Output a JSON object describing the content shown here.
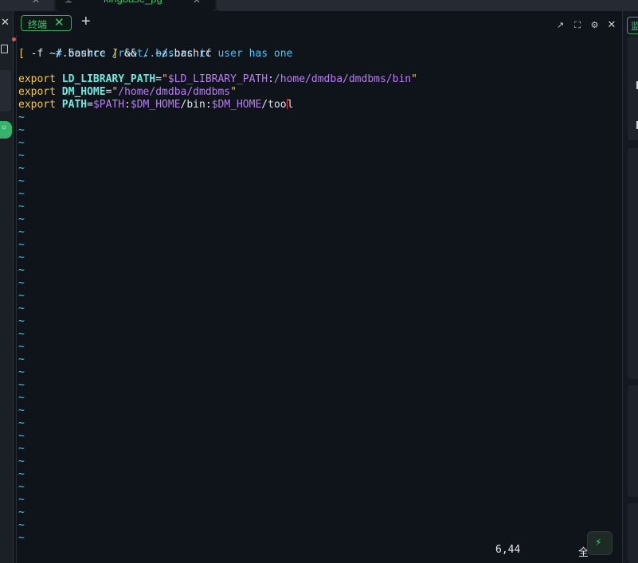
{
  "app_tabs": {
    "tab1_close": "✕",
    "tab2_pin": "⟂",
    "tab2_label": "kingbase_pg",
    "tab2_close": "✕"
  },
  "left_sidebar": {
    "close": "✕",
    "pill": "○"
  },
  "terminal_header": {
    "tab_label": "终端",
    "tab_close": "✕",
    "add": "+",
    "icons": {
      "external": "↗",
      "expand": "⛶",
      "settings": "⚙",
      "close": "✕"
    }
  },
  "terminal": {
    "lines": {
      "l1": "# Source /root/.bashrc if user has one",
      "l2_open": "[",
      "l2_mid": " -f ~/.bashrc ",
      "l2_close": "]",
      "l2_tail": " && . ~/.bashrc",
      "l4": {
        "kw": "export",
        "var": "LD_LIBRARY_PATH",
        "eq": "=",
        "q1": "\"",
        "ref": "$LD_LIBRARY_PATH",
        "sep": ":",
        "path": "/home/dmdba/dmdbms/bin",
        "q2": "\""
      },
      "l5": {
        "kw": "export",
        "var": "DM_HOME",
        "eq": "=",
        "q1": "\"",
        "path": "/home/dmdba/dmdbms",
        "q2": "\""
      },
      "l6": {
        "kw": "export",
        "var": "PATH",
        "eq": "=",
        "ref1": "$PATH",
        "sep1": ":",
        "ref2": "$DM_HOME",
        "p1": "/bin",
        "sep2": ":",
        "ref3": "$DM_HOME",
        "p2": "/too",
        "p3": "l"
      }
    },
    "tilde": "~",
    "status_position": "6,44",
    "status_all": "全",
    "bolt": "⚡"
  },
  "right_panel": {
    "tab": "监"
  },
  "colors": {
    "background": "#0f131a",
    "comment": "#56c1f0",
    "keyword": "#f2c94c",
    "variable": "#6fe8e0",
    "path": "#b87ff0",
    "accent_green": "#3aa864"
  }
}
